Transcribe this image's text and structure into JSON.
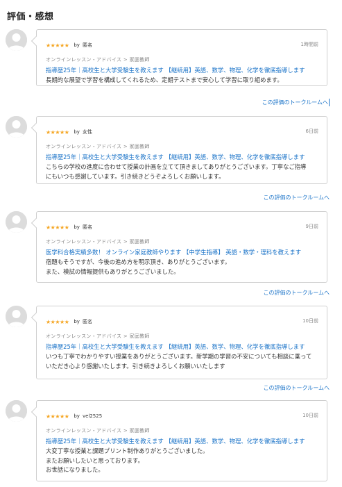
{
  "section_title": "評価・感想",
  "reviews": [
    {
      "stars": "★★★★★",
      "by_label": "by",
      "reviewer": "匿名",
      "timestamp": "1時間前",
      "category": "オンラインレッスン・アドバイス > 家庭教師",
      "service_title": "指導歴25年｜高校生と大学受験生を教えます 【継続用】英語、数学、物理、化学を徹底指導します",
      "comment_lines": [
        "長期的な展望で学習を構成してくれるため、定期テストまで安心して学習に取り組めます。"
      ],
      "talk_link": "この評価のトークルームへ"
    },
    {
      "stars": "★★★★★",
      "by_label": "by",
      "reviewer": "女性",
      "timestamp": "6日前",
      "category": "オンラインレッスン・アドバイス > 家庭教師",
      "service_title": "指導歴25年｜高校生と大学受験生を教えます 【継続用】英語、数学、物理、化学を徹底指導します",
      "comment_lines": [
        "こちらの学校の進度に合わせて授業の計画を立てて頂きましてありがとうございます。丁寧なご指導",
        "にもいつも感謝しています。引き続きどうぞよろしくお願いします。"
      ],
      "talk_link": "この評価のトークルームへ"
    },
    {
      "stars": "★★★★★",
      "by_label": "by",
      "reviewer": "匿名",
      "timestamp": "9日前",
      "category": "オンラインレッスン・アドバイス > 家庭教師",
      "service_title": "医学科合格実績多数！ オンライン家庭教師やります 【中学生指導】 英語・数学・理科を教えます",
      "comment_lines": [
        "宿題もそうですが、今後の進め方を明示頂き、ありがとうございます。",
        "また、模試の情報提供もありがとうございました。"
      ],
      "talk_link": "この評価のトークルームへ"
    },
    {
      "stars": "★★★★★",
      "by_label": "by",
      "reviewer": "匿名",
      "timestamp": "10日前",
      "category": "オンラインレッスン・アドバイス > 家庭教師",
      "service_title": "指導歴25年｜高校生と大学受験生を教えます 【継続用】英語、数学、物理、化学を徹底指導します",
      "comment_lines": [
        "いつも丁寧でわかりやすい授業をありがとうございます。新学期の学習の不安についても相談に乗って",
        "いただき心より感謝いたします。引き続きよろしくお願いいたします"
      ],
      "talk_link": "この評価のトークルームへ"
    },
    {
      "stars": "★★★★★",
      "by_label": "by",
      "reviewer": "vel2525",
      "timestamp": "10日前",
      "category": "オンラインレッスン・アドバイス > 家庭教師",
      "service_title": "指導歴25年｜高校生と大学受験生を教えます 【継続用】英語、数学、物理、化学を徹底指導します",
      "comment_lines": [
        "大変丁寧な授業と課題プリント制作ありがとうございました。",
        "またお願いしたいと思っております。",
        "お世話になりました。"
      ],
      "talk_link": ""
    }
  ],
  "colors": {
    "link": "#1a73c8",
    "star": "#f5a623",
    "muted": "#888888",
    "border": "#cfcfcf",
    "avatar": "#dcdcdc"
  },
  "icons": {
    "avatar": "default-user-avatar-icon",
    "star": "star-icon"
  }
}
